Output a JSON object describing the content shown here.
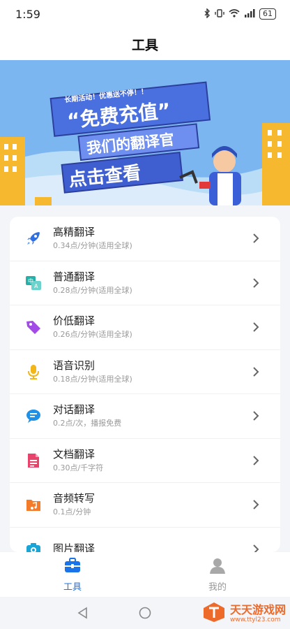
{
  "status": {
    "time": "1:59",
    "battery": "61"
  },
  "header": {
    "title": "工具"
  },
  "banner": {
    "tagline": "长期活动！优惠送不停！！",
    "headline": "“免费充值”",
    "subtitle": "我们的翻译官",
    "cta": "点击查看"
  },
  "tools": [
    {
      "name": "高精翻译",
      "desc": "0.34点/分钟(适用全球)",
      "icon": "rocket-icon"
    },
    {
      "name": "普通翻译",
      "desc": "0.28点/分钟(适用全球)",
      "icon": "translate-icon"
    },
    {
      "name": "价低翻译",
      "desc": "0.26点/分钟(适用全球)",
      "icon": "tag-icon"
    },
    {
      "name": "语音识别",
      "desc": "0.18点/分钟(适用全球)",
      "icon": "microphone-icon"
    },
    {
      "name": "对话翻译",
      "desc": "0.2点/次，播报免费",
      "icon": "chat-icon"
    },
    {
      "name": "文档翻译",
      "desc": "0.30点/千字符",
      "icon": "document-icon"
    },
    {
      "name": "音频转写",
      "desc": "0.1点/分钟",
      "icon": "audio-folder-icon"
    },
    {
      "name": "图片翻译",
      "desc": "",
      "icon": "camera-icon"
    }
  ],
  "tabs": [
    {
      "label": "工具",
      "icon": "toolbox-icon",
      "active": true
    },
    {
      "label": "我的",
      "icon": "user-icon",
      "active": false
    }
  ],
  "watermark": {
    "title": "天天游戏网",
    "url": "www.ttyl23.com"
  },
  "colors": {
    "accent": "#1a73e8",
    "background": "#f3f5f9",
    "banner_sky": "#7cb6f0"
  }
}
